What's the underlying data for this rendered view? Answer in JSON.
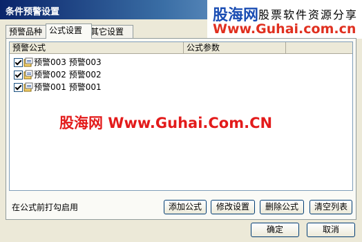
{
  "window": {
    "title": "条件预警设置"
  },
  "watermark_top": {
    "logo": "股海网",
    "tagline": "股票软件资源分享",
    "url": "Www.Guhai.com.cn"
  },
  "tabs": [
    {
      "label": "预警品种",
      "active": false
    },
    {
      "label": "公式设置",
      "active": true
    },
    {
      "label": "其它设置",
      "active": false
    }
  ],
  "list": {
    "columns": [
      "预警公式",
      "公式参数"
    ],
    "rows": [
      {
        "checked": true,
        "label": "预警003 预警003"
      },
      {
        "checked": true,
        "label": "预警002 预警002"
      },
      {
        "checked": true,
        "label": "预警001 预警001"
      }
    ]
  },
  "watermark_mid": "股海网 Www.Guhai.Com.CN",
  "hint": "在公式前打勾启用",
  "buttons": {
    "add": "添加公式",
    "edit": "修改设置",
    "delete": "删除公式",
    "clear": "清空列表",
    "ok": "确定",
    "cancel": "取消"
  },
  "colors": {
    "accent_red": "#e31b1b",
    "accent_blue": "#1a4db3"
  }
}
